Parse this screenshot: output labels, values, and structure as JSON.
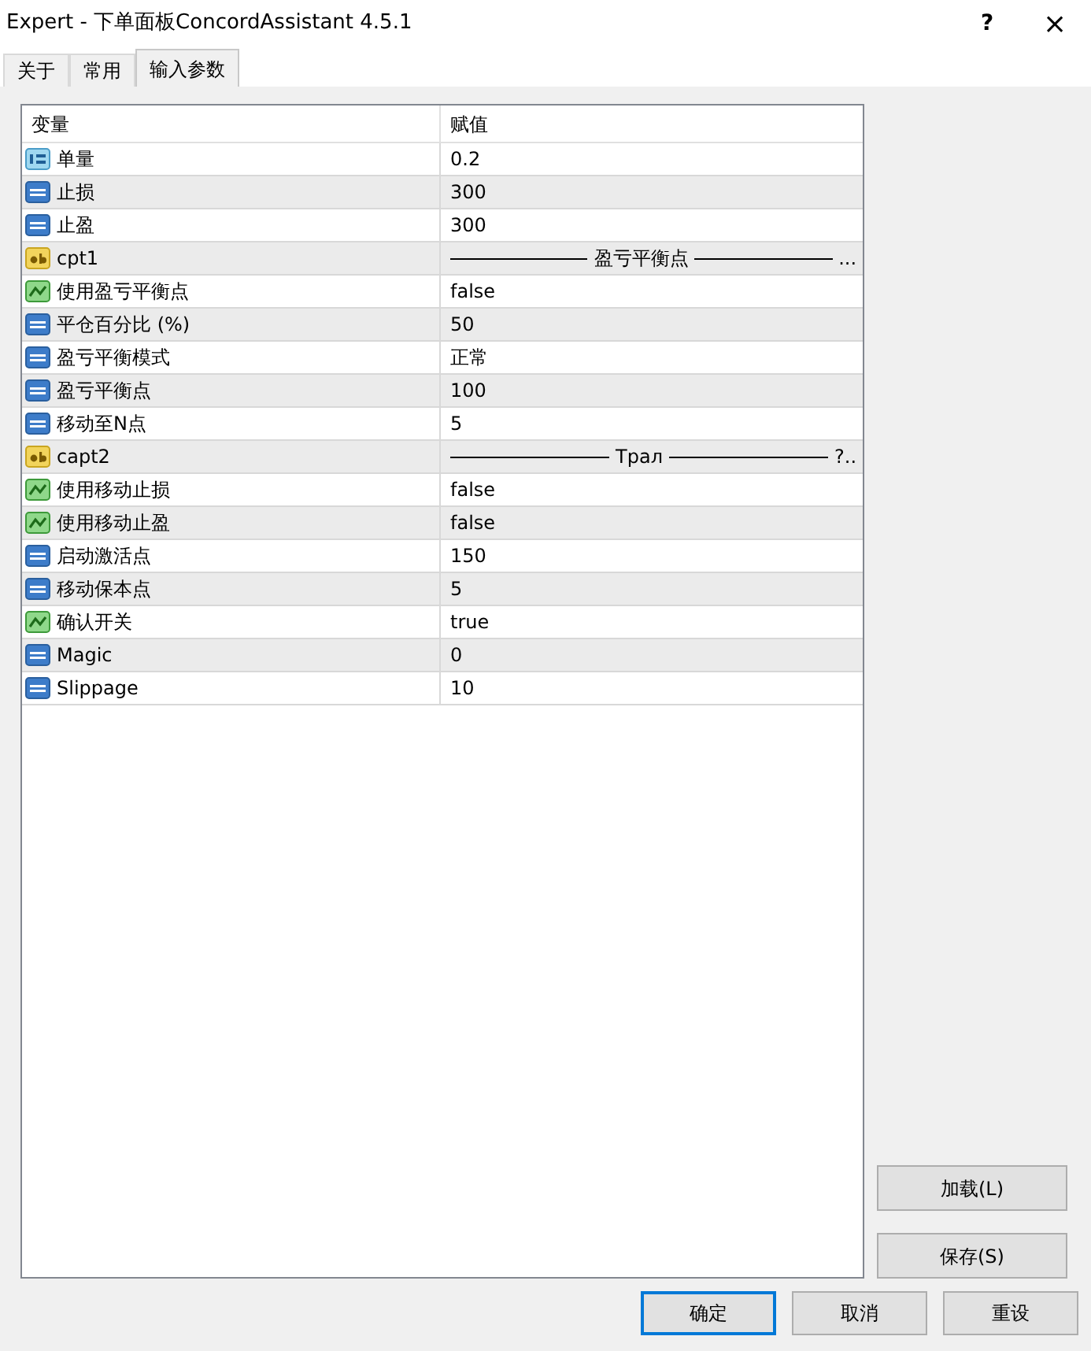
{
  "window": {
    "title": "Expert - 下单面板ConcordAssistant 4.5.1",
    "help": "?",
    "close": "×"
  },
  "tabs": [
    {
      "label": "关于",
      "selected": false
    },
    {
      "label": "常用",
      "selected": false
    },
    {
      "label": "输入参数",
      "selected": true
    }
  ],
  "table": {
    "columns": [
      "变量",
      "赋值"
    ],
    "rows": [
      {
        "kind": "double",
        "name": "单量",
        "value": "0.2"
      },
      {
        "kind": "int",
        "name": "止损",
        "value": "300"
      },
      {
        "kind": "int",
        "name": "止盈",
        "value": "300"
      },
      {
        "kind": "string",
        "name": "cpt1",
        "separator": {
          "label": "盈亏平衡点",
          "tail": "..."
        }
      },
      {
        "kind": "bool",
        "name": "使用盈亏平衡点",
        "value": "false"
      },
      {
        "kind": "int",
        "name": "平仓百分比 (%)",
        "value": "50"
      },
      {
        "kind": "int",
        "name": "盈亏平衡模式",
        "value": "正常"
      },
      {
        "kind": "int",
        "name": "盈亏平衡点",
        "value": "100"
      },
      {
        "kind": "int",
        "name": "移动至N点",
        "value": "5"
      },
      {
        "kind": "string",
        "name": "capt2",
        "separator": {
          "label": "Трал",
          "tail": "?.."
        }
      },
      {
        "kind": "bool",
        "name": "使用移动止损",
        "value": "false"
      },
      {
        "kind": "bool",
        "name": "使用移动止盈",
        "value": "false"
      },
      {
        "kind": "int",
        "name": "启动激活点",
        "value": "150"
      },
      {
        "kind": "int",
        "name": "移动保本点",
        "value": "5"
      },
      {
        "kind": "bool",
        "name": "确认开关",
        "value": "true"
      },
      {
        "kind": "int",
        "name": "Magic",
        "value": "0"
      },
      {
        "kind": "int",
        "name": "Slippage",
        "value": "10"
      }
    ]
  },
  "side_buttons": [
    "加载(L)",
    "保存(S)"
  ],
  "footer_buttons": [
    {
      "label": "确定",
      "default": true
    },
    {
      "label": "取消",
      "default": false
    },
    {
      "label": "重设",
      "default": false
    }
  ]
}
